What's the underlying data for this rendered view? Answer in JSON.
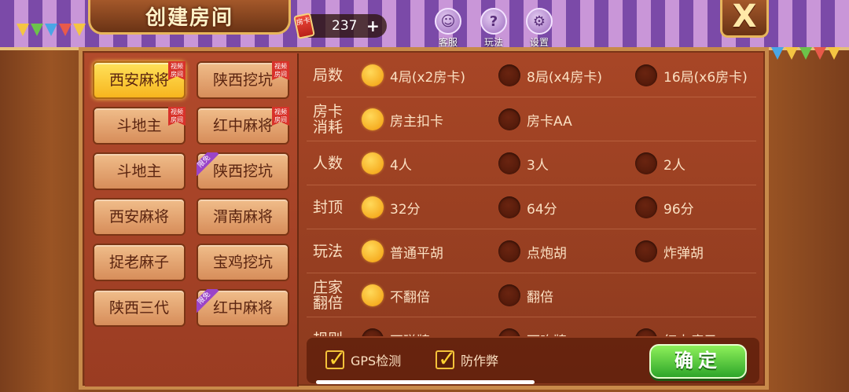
{
  "header": {
    "title": "创建房间",
    "room_card": {
      "icon_label": "房卡",
      "count": "237",
      "add_label": "+"
    },
    "buttons": [
      {
        "label": "客服",
        "icon": "service-icon",
        "glyph": "☺"
      },
      {
        "label": "玩法",
        "icon": "help-icon",
        "glyph": "?"
      },
      {
        "label": "设置",
        "icon": "gear-icon",
        "glyph": "⚙"
      }
    ],
    "close_label": "X"
  },
  "games": [
    {
      "label": "西安麻将",
      "active": true,
      "tag": "视频房间"
    },
    {
      "label": "陕西挖坑",
      "active": false,
      "tag": "视频房间"
    },
    {
      "label": "斗地主",
      "active": false,
      "tag": "视频房间"
    },
    {
      "label": "红中麻将",
      "active": false,
      "tag": "视频房间"
    },
    {
      "label": "斗地主",
      "active": false,
      "tag": ""
    },
    {
      "label": "陕西挖坑",
      "active": false,
      "tag": "限免"
    },
    {
      "label": "西安麻将",
      "active": false,
      "tag": ""
    },
    {
      "label": "渭南麻将",
      "active": false,
      "tag": ""
    },
    {
      "label": "捉老麻子",
      "active": false,
      "tag": ""
    },
    {
      "label": "宝鸡挖坑",
      "active": false,
      "tag": ""
    },
    {
      "label": "陕西三代",
      "active": false,
      "tag": ""
    },
    {
      "label": "红中麻将",
      "active": false,
      "tag": "限免"
    }
  ],
  "options": [
    {
      "label": "局数",
      "choices": [
        "4局(x2房卡)",
        "8局(x4房卡)",
        "16局(x6房卡)"
      ],
      "selected": 0
    },
    {
      "label": "房卡消耗",
      "choices": [
        "房主扣卡",
        "房卡AA"
      ],
      "selected": 0
    },
    {
      "label": "人数",
      "choices": [
        "4人",
        "3人",
        "2人"
      ],
      "selected": 0
    },
    {
      "label": "封顶",
      "choices": [
        "32分",
        "64分",
        "96分"
      ],
      "selected": 0
    },
    {
      "label": "玩法",
      "choices": [
        "普通平胡",
        "点炮胡",
        "炸弹胡"
      ],
      "selected": 0
    },
    {
      "label": "庄家翻倍",
      "choices": [
        "不翻倍",
        "翻倍"
      ],
      "selected": 0
    },
    {
      "label": "规则",
      "choices": [
        "不碰牌",
        "可吃牌",
        "红中癞子"
      ],
      "selected": -1
    }
  ],
  "footer": {
    "gps_label": "GPS检测",
    "anti_cheat_label": "防作弊",
    "confirm_label": "确定"
  }
}
